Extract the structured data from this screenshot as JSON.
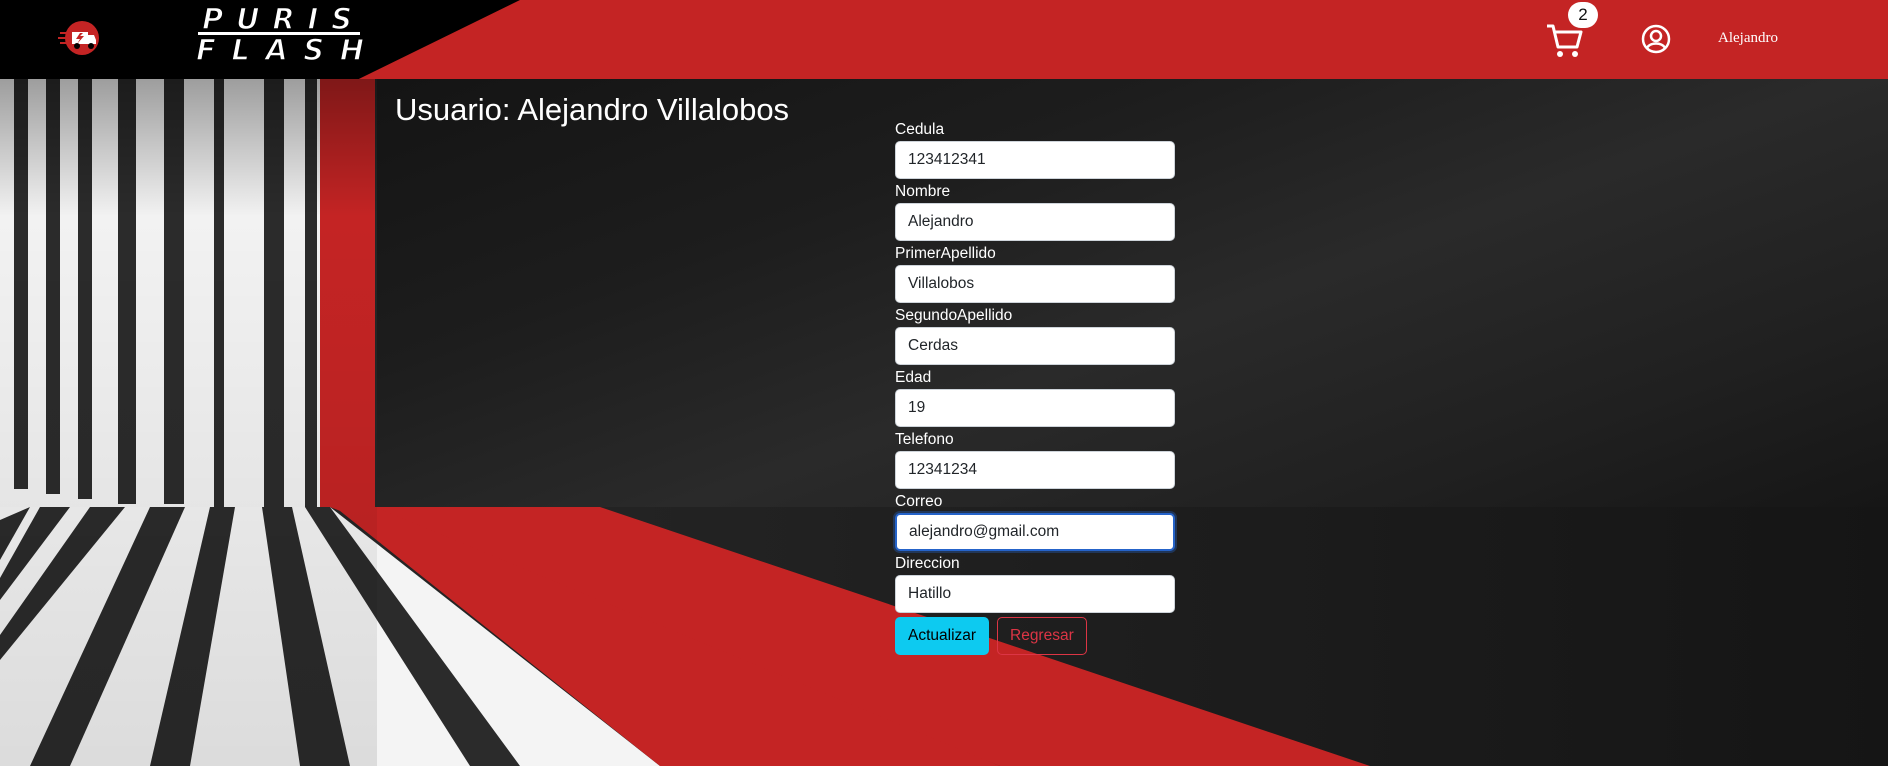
{
  "header": {
    "brand_name": "PURIS FLASH",
    "cart_count": "2",
    "username": "Alejandro"
  },
  "main": {
    "title": "Usuario: Alejandro Villalobos",
    "form": {
      "fields": [
        {
          "label": "Cedula",
          "value": "123412341"
        },
        {
          "label": "Nombre",
          "value": "Alejandro"
        },
        {
          "label": "PrimerApellido",
          "value": "Villalobos"
        },
        {
          "label": "SegundoApellido",
          "value": "Cerdas"
        },
        {
          "label": "Edad",
          "value": "19"
        },
        {
          "label": "Telefono",
          "value": "12341234"
        },
        {
          "label": "Correo",
          "value": "alejandro@gmail.com"
        },
        {
          "label": "Direccion",
          "value": "Hatillo"
        }
      ],
      "submit_label": "Actualizar",
      "back_label": "Regresar"
    }
  },
  "colors": {
    "brand_red": "#c42424",
    "primary_button": "#0dcaf0",
    "secondary_button": "#dc3545"
  }
}
